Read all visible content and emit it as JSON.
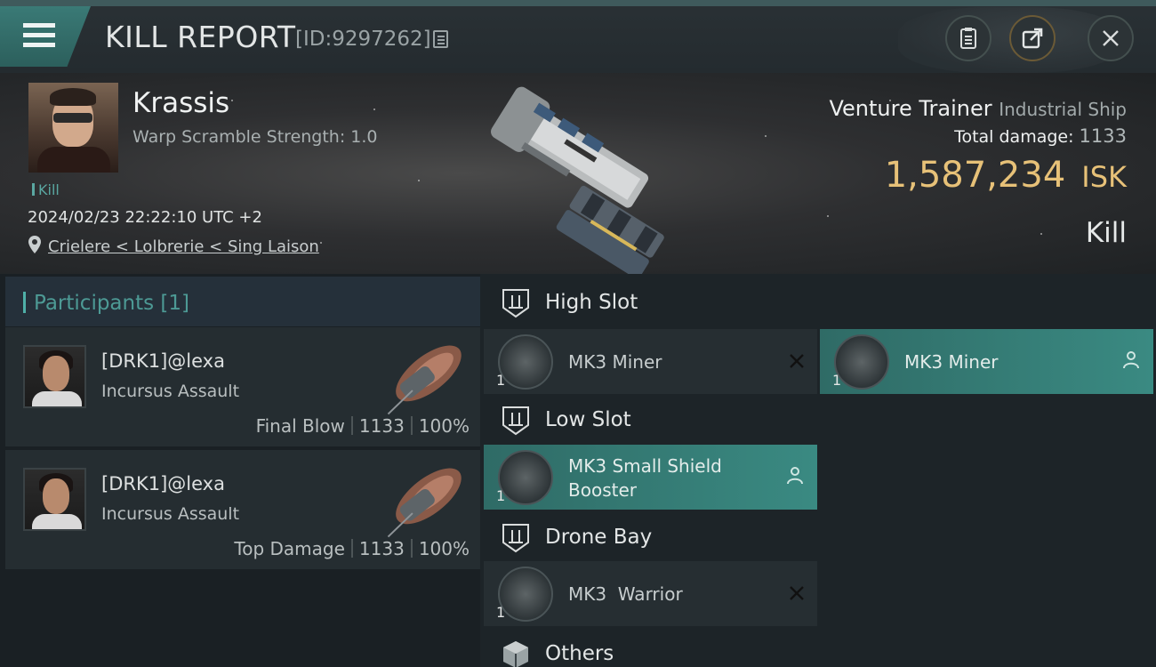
{
  "header": {
    "title": "KILL REPORT",
    "id": "[ID:9297262]"
  },
  "victim": {
    "name": "Krassis",
    "warp_scramble": "Warp Scramble Strength: 1.0",
    "kill_tag": "Kill",
    "datetime": "2024/02/23 22:22:10 UTC +2",
    "location": "Crielere < Lolbrerie < Sing Laison",
    "ship_name": "Venture Trainer",
    "ship_class": "Industrial Ship",
    "total_damage_label": "Total damage:",
    "total_damage": "1133",
    "isk_value": "1,587,234",
    "isk_unit": "ISK",
    "result": "Kill"
  },
  "participants": {
    "title": "Participants [1]",
    "list": [
      {
        "name": "[DRK1]@lexa",
        "ship": "Incursus Assault",
        "role": "Final Blow",
        "damage": "1133",
        "percent": "100%"
      },
      {
        "name": "[DRK1]@lexa",
        "ship": "Incursus Assault",
        "role": "Top Damage",
        "damage": "1133",
        "percent": "100%"
      }
    ]
  },
  "fitting": {
    "high_slot": {
      "label": "High Slot",
      "items": [
        {
          "name": "MK3 Miner",
          "qty": "1",
          "state": "destroyed",
          "icon": "miner-module-icon"
        },
        {
          "name": "MK3 Miner",
          "qty": "1",
          "state": "dropped",
          "icon": "miner-module-icon"
        }
      ]
    },
    "low_slot": {
      "label": "Low Slot",
      "items": [
        {
          "name": "MK3 Small Shield Booster",
          "qty": "1",
          "state": "dropped",
          "icon": "shield-booster-icon"
        }
      ]
    },
    "drone_bay": {
      "label": "Drone Bay",
      "items": [
        {
          "name": "MK3  Warrior",
          "qty": "1",
          "state": "destroyed",
          "icon": "drone-icon"
        }
      ]
    },
    "others": {
      "label": "Others"
    }
  },
  "colors": {
    "accent": "#4fb0a8",
    "isk_gold": "#e7c178",
    "dropped_highlight": "#3a8a82",
    "panel": "#262e32"
  }
}
